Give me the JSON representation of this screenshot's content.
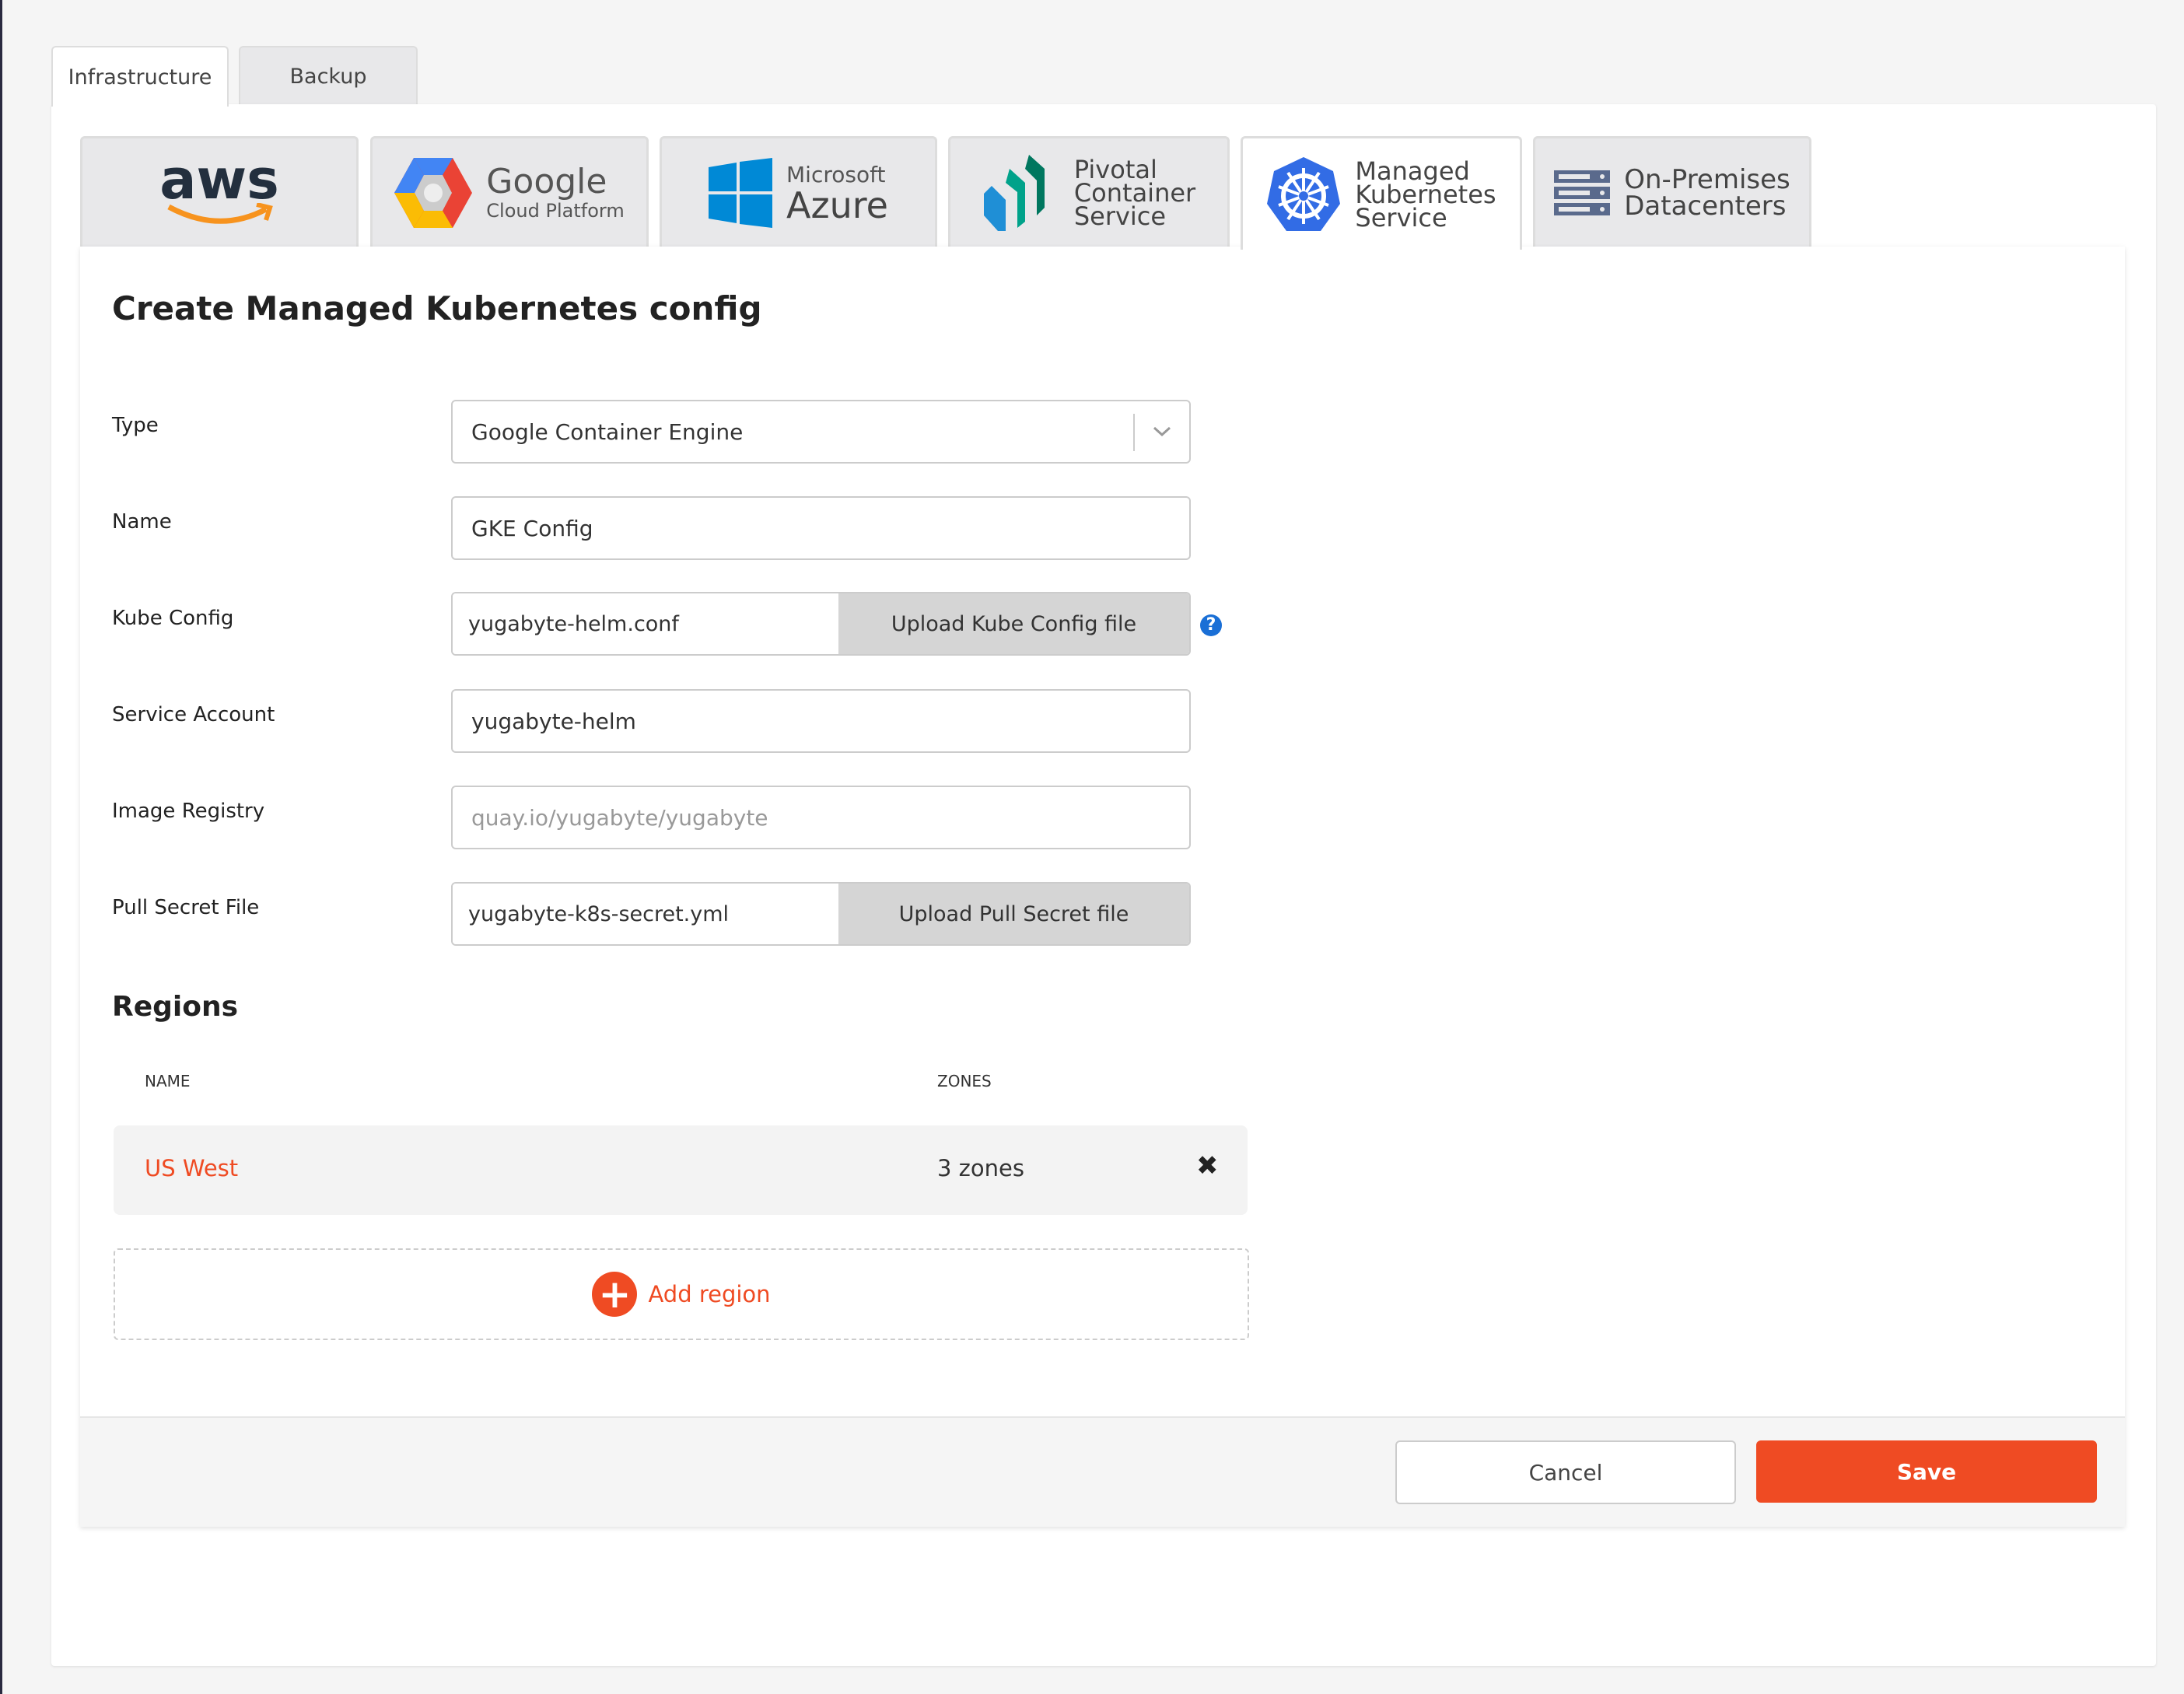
{
  "top_tabs": [
    {
      "label": "Infrastructure",
      "active": true
    },
    {
      "label": "Backup",
      "active": false
    }
  ],
  "providers": [
    {
      "label": "aws",
      "icon": "aws-logo"
    },
    {
      "label": "Google",
      "sub": "Cloud Platform",
      "icon": "google-cloud-logo"
    },
    {
      "label": "Microsoft",
      "sub": "Azure",
      "icon": "azure-logo"
    },
    {
      "label": "Pivotal Container Service",
      "line1": "Pivotal",
      "line2": "Container",
      "line3": "Service",
      "icon": "pivotal-logo"
    },
    {
      "label": "Managed Kubernetes Service",
      "line1": "Managed",
      "line2": "Kubernetes",
      "line3": "Service",
      "icon": "kubernetes-logo",
      "active": true
    },
    {
      "label": "On-Premises Datacenters",
      "line1": "On-Premises",
      "line2": "Datacenters",
      "icon": "server-rack-icon"
    }
  ],
  "form": {
    "title": "Create Managed Kubernetes config",
    "type": {
      "label": "Type",
      "value": "Google Container Engine"
    },
    "name": {
      "label": "Name",
      "value": "GKE Config"
    },
    "kube_config": {
      "label": "Kube Config",
      "file": "yugabyte-helm.conf",
      "button": "Upload Kube Config file"
    },
    "service_account": {
      "label": "Service Account",
      "value": "yugabyte-helm"
    },
    "image_registry": {
      "label": "Image Registry",
      "placeholder": "quay.io/yugabyte/yugabyte"
    },
    "pull_secret": {
      "label": "Pull Secret File",
      "file": "yugabyte-k8s-secret.yml",
      "button": "Upload Pull Secret file"
    }
  },
  "regions": {
    "heading": "Regions",
    "columns": [
      "NAME",
      "ZONES"
    ],
    "rows": [
      {
        "name": "US West",
        "zones": "3 zones"
      }
    ],
    "add_label": "Add region"
  },
  "footer": {
    "cancel": "Cancel",
    "save": "Save"
  },
  "colors": {
    "accent": "#ef4b23",
    "help": "#1a6fd6",
    "k8s": "#326ce5"
  }
}
